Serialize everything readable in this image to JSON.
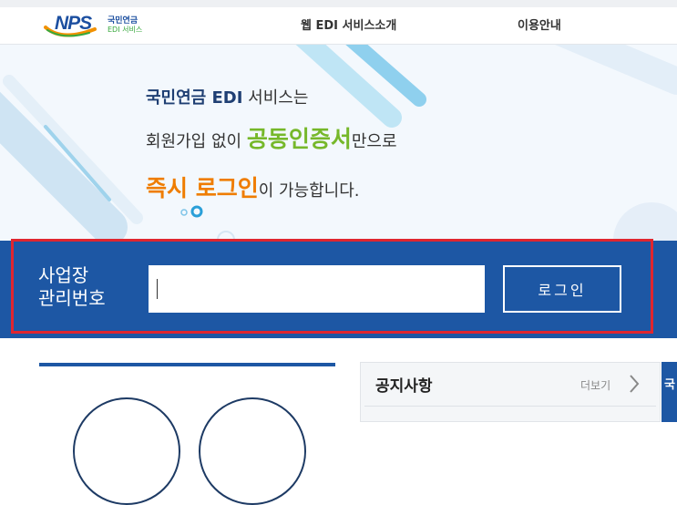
{
  "header": {
    "logo_text": "NPS",
    "logo_sub1": "국민연금",
    "logo_sub2": "EDI 서비스",
    "nav": [
      "웹 EDI 서비스소개",
      "이용안내"
    ]
  },
  "hero": {
    "line1_strong": "국민연금 EDI",
    "line1_rest": " 서비스는",
    "line2_pre": "회원가입 없이 ",
    "line2_highlight": "공동인증서",
    "line2_post": "만으로",
    "line3_highlight": "즉시 로그인",
    "line3_post": "이 가능합니다."
  },
  "login": {
    "label_line1": "사업장",
    "label_line2": "관리번호",
    "input_value": "",
    "button_label": "로그인"
  },
  "notice": {
    "title": "공지사항",
    "more_label": "더보기",
    "side_tab_label": "국"
  },
  "colors": {
    "brand_blue": "#1d57a4",
    "highlight_green": "#76b82a",
    "highlight_orange": "#ef7d00",
    "focus_red": "#e0262f"
  }
}
